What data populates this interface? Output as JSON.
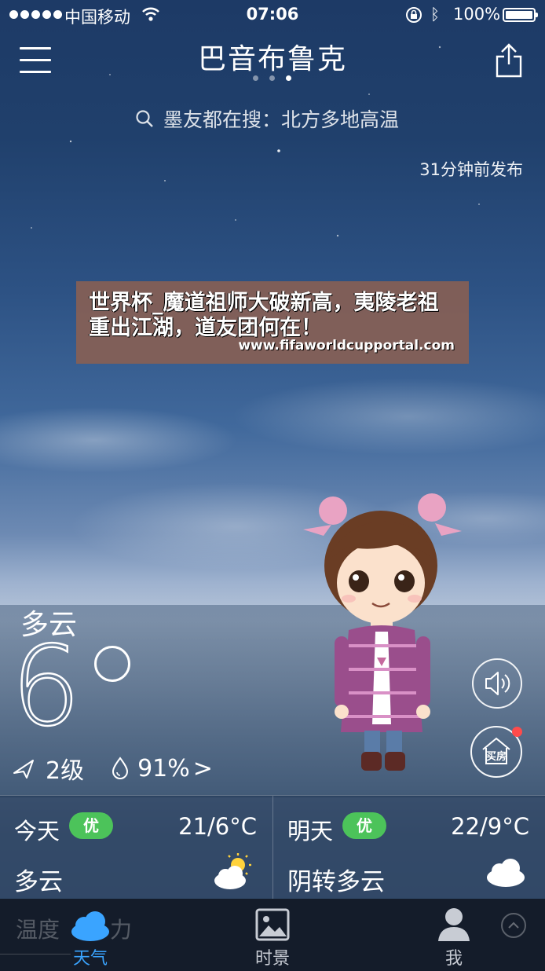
{
  "status_bar": {
    "carrier": "中国移动",
    "time": "07:06",
    "battery": "100%"
  },
  "header": {
    "city": "巴音布鲁克",
    "page_count": 3,
    "active_page": 3
  },
  "search": {
    "text": "墨友都在搜：北方多地高温"
  },
  "published": "31分钟前发布",
  "ad_banner": {
    "headline": "世界杯_魔道祖师大破新高，夷陵老祖重出江湖，道友团何在！",
    "url": "www.fifaworldcupportal.com"
  },
  "current": {
    "condition": "多云",
    "temperature": "6",
    "wind": "2级",
    "humidity": "91%",
    "humidity_arrow": ">"
  },
  "side_buttons": {
    "house_label": "买房"
  },
  "forecast": [
    {
      "day": "今天",
      "aqi": "优",
      "range": "21/6°C",
      "desc": "多云",
      "icon": "partly-sunny"
    },
    {
      "day": "明天",
      "aqi": "优",
      "range": "22/9°C",
      "desc": "阴转多云",
      "icon": "cloudy"
    }
  ],
  "tabbar": {
    "ghost_text_1": "温度",
    "ghost_text_2": "力",
    "tabs": [
      {
        "label": "天气",
        "active": true
      },
      {
        "label": "时景",
        "active": false
      },
      {
        "label": "我",
        "active": false
      }
    ]
  },
  "colors": {
    "accent": "#3aa4ff",
    "aqi_good": "#4cc35a",
    "badge": "#ff4b4b",
    "banner_bg": "#876055"
  }
}
